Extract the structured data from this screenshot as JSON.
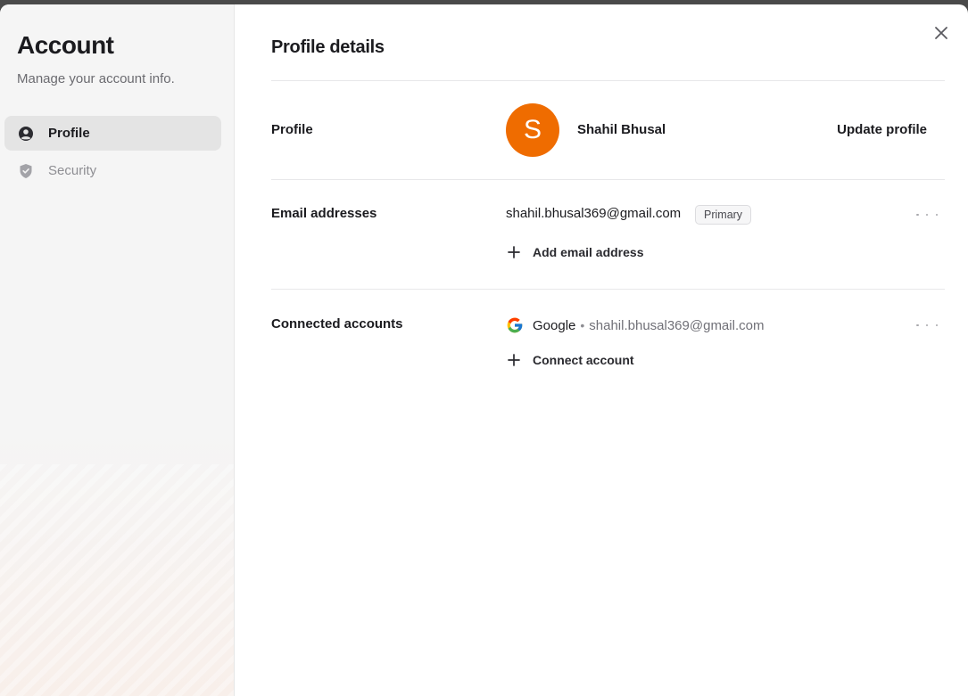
{
  "sidebar": {
    "title": "Account",
    "subtitle": "Manage your account info.",
    "items": [
      {
        "label": "Profile",
        "icon": "user-circle-icon",
        "active": true
      },
      {
        "label": "Security",
        "icon": "shield-icon",
        "active": false
      }
    ]
  },
  "main": {
    "title": "Profile details",
    "profile": {
      "label": "Profile",
      "avatar_initial": "S",
      "avatar_color": "#ef6c00",
      "name": "Shahil Bhusal",
      "update_label": "Update profile"
    },
    "emails": {
      "label": "Email addresses",
      "address": "shahil.bhusal369@gmail.com",
      "badge": "Primary",
      "add_label": "Add email address"
    },
    "connected": {
      "label": "Connected accounts",
      "provider": "Google",
      "separator": "•",
      "email": "shahil.bhusal369@gmail.com",
      "connect_label": "Connect account"
    }
  },
  "colors": {
    "accent": "#ef6c00",
    "sidebar_bg": "#f5f5f5",
    "active_item_bg": "#e4e4e4"
  }
}
